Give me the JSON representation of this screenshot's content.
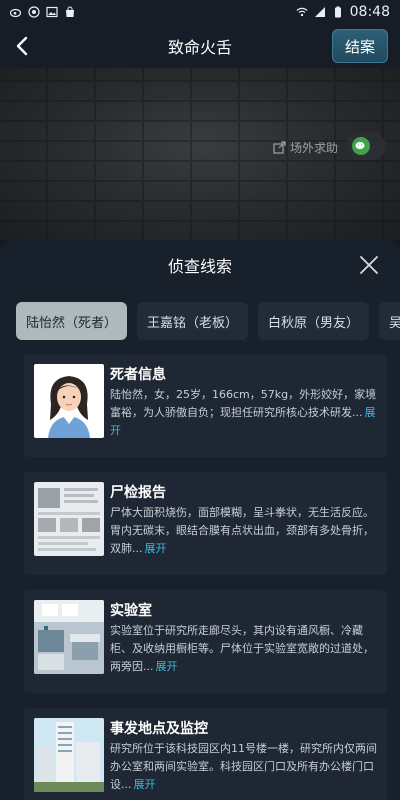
{
  "status": {
    "time": "08:48"
  },
  "nav": {
    "title": "致命火舌",
    "close_case": "结案"
  },
  "scene": {
    "help_label": "场外求助"
  },
  "panel": {
    "title": "侦查线索"
  },
  "tabs": [
    {
      "label": "陆怡然（死者）",
      "active": true
    },
    {
      "label": "王嘉铭（老板）",
      "active": false
    },
    {
      "label": "白秋原（男友）",
      "active": false
    },
    {
      "label": "吴昕晨",
      "active": false
    }
  ],
  "clues": [
    {
      "title": "死者信息",
      "desc": "陆怡然，女，25岁，166cm，57kg，外形姣好，家境富裕，为人骄傲自负；现担任研究所核心技术研发...",
      "expand": "展开"
    },
    {
      "title": "尸检报告",
      "desc": "尸体大面积烧伤，面部模糊，呈斗拳状，无生活反应。胃内无碳末，眼结合膜有点状出血，颈部有多处骨折，双肺...",
      "expand": "展开"
    },
    {
      "title": "实验室",
      "desc": "实验室位于研究所走廊尽头，其内设有通风橱、冷藏柜、及收纳用橱柜等。尸体位于实验室宽敞的过道处，两旁因...",
      "expand": "展开"
    },
    {
      "title": "事发地点及监控",
      "desc": "研究所位于该科技园区内11号楼一楼，研究所内仅两间办公室和两间实验室。科技园区门口及所有办公楼门口设...",
      "expand": "展开"
    }
  ]
}
